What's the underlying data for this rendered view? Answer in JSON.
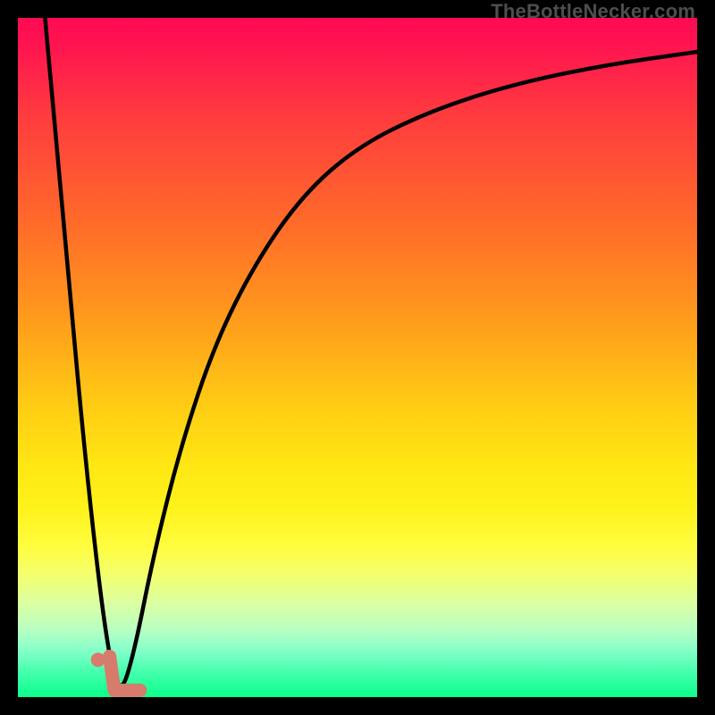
{
  "watermark": "TheBottleNecker.com",
  "chart_data": {
    "type": "line",
    "title": "",
    "xlabel": "",
    "ylabel": "",
    "xlim": [
      0,
      1
    ],
    "ylim": [
      0,
      1
    ],
    "note": "Axes unlabeled; values are normalized [0,1]. y represents bottleneck severity (0=green/good at bottom, 1=red/bad at top). Curve falls sharply from x≈0.04,y≈1 to a minimum near x≈0.15,y≈0 then rises asymptotically toward y≈0.95 as x→1.",
    "series": [
      {
        "name": "bottleneck-curve",
        "x": [
          0.04,
          0.07,
          0.1,
          0.13,
          0.15,
          0.17,
          0.2,
          0.24,
          0.29,
          0.35,
          0.42,
          0.5,
          0.6,
          0.72,
          0.86,
          1.0
        ],
        "y": [
          1.0,
          0.67,
          0.34,
          0.08,
          0.0,
          0.06,
          0.21,
          0.37,
          0.52,
          0.64,
          0.74,
          0.81,
          0.86,
          0.9,
          0.93,
          0.95
        ]
      }
    ],
    "markers": [
      {
        "name": "dot",
        "x": 0.118,
        "y": 0.055
      },
      {
        "name": "hook",
        "points_xy": [
          [
            0.135,
            0.06
          ],
          [
            0.142,
            0.01
          ],
          [
            0.18,
            0.01
          ]
        ]
      }
    ],
    "background_gradient_stops": [
      {
        "pos": 0.0,
        "color": "#ff0a52"
      },
      {
        "pos": 0.3,
        "color": "#ff6a2a"
      },
      {
        "pos": 0.56,
        "color": "#ffc814"
      },
      {
        "pos": 0.78,
        "color": "#fffd40"
      },
      {
        "pos": 1.0,
        "color": "#0aff8c"
      }
    ]
  }
}
